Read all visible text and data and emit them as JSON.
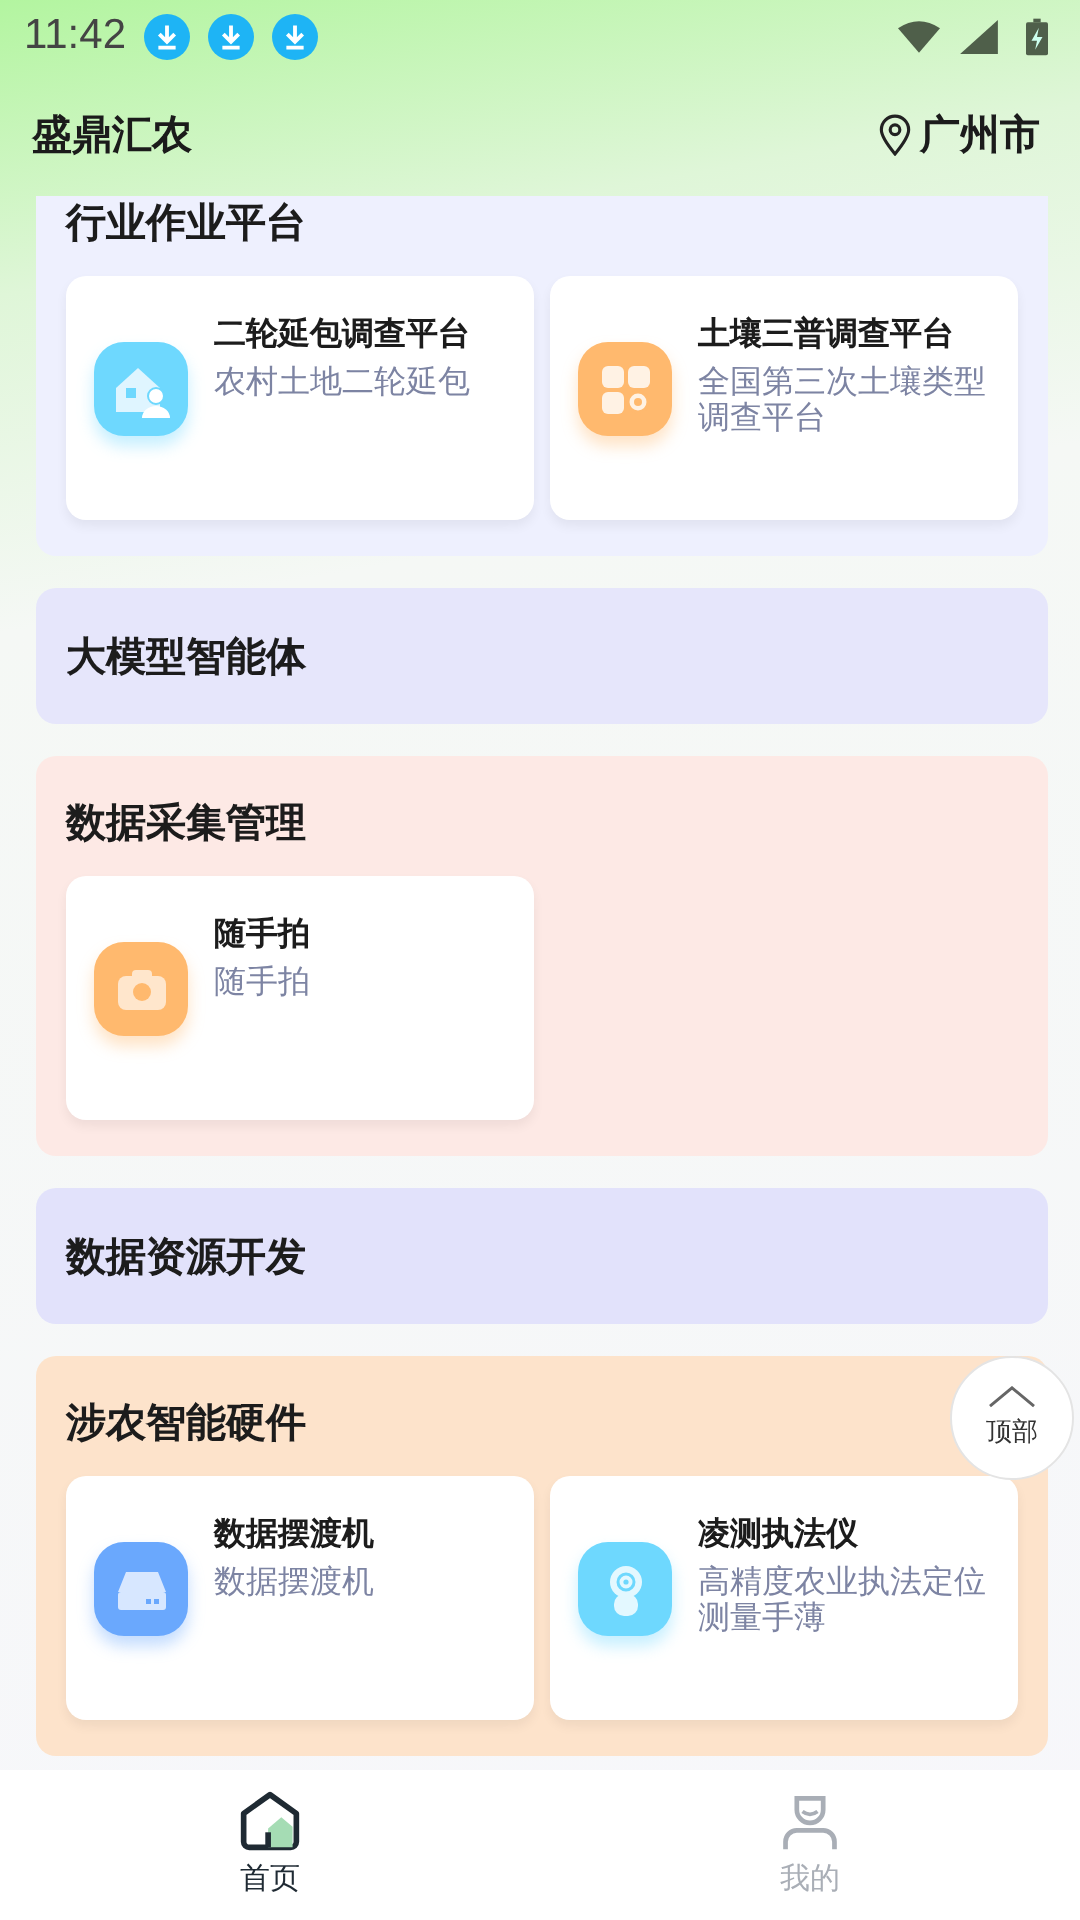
{
  "status_bar": {
    "time": "11:42"
  },
  "header": {
    "title": "盛鼎汇农",
    "location": "广州市"
  },
  "sections": [
    {
      "title": "行业作业平台",
      "color": "#eef0fe",
      "items": [
        {
          "kind": "house",
          "title": "二轮延包调查平台",
          "subtitle": "农村土地二轮延包",
          "color": "#6ed8fe"
        },
        {
          "kind": "grid",
          "title": "土壤三普调查平台",
          "subtitle": "全国第三次土壤类型调查平台",
          "color": "#ffb96e"
        }
      ]
    },
    {
      "title": "大模型智能体",
      "color": "#e6e6fb"
    },
    {
      "title": "数据采集管理",
      "color": "#fde9e5",
      "items": [
        {
          "kind": "camera",
          "title": "随手拍",
          "subtitle": "随手拍",
          "color": "#ffb96e"
        }
      ]
    },
    {
      "title": "数据资源开发",
      "color": "#e2e2fb"
    },
    {
      "title": "涉农智能硬件",
      "color": "#fde3cb",
      "items": [
        {
          "kind": "drive",
          "title": "数据摆渡机",
          "subtitle": "数据摆渡机",
          "color": "#6aa8fd"
        },
        {
          "kind": "device",
          "title": "凌测执法仪",
          "subtitle": "高精度农业执法定位测量手薄",
          "color": "#6ed8fe"
        }
      ]
    }
  ],
  "back_to_top": {
    "label": "顶部"
  },
  "tabs": [
    {
      "kind": "home",
      "label": "首页",
      "selected": true
    },
    {
      "kind": "person",
      "label": "我的",
      "selected": false
    }
  ]
}
